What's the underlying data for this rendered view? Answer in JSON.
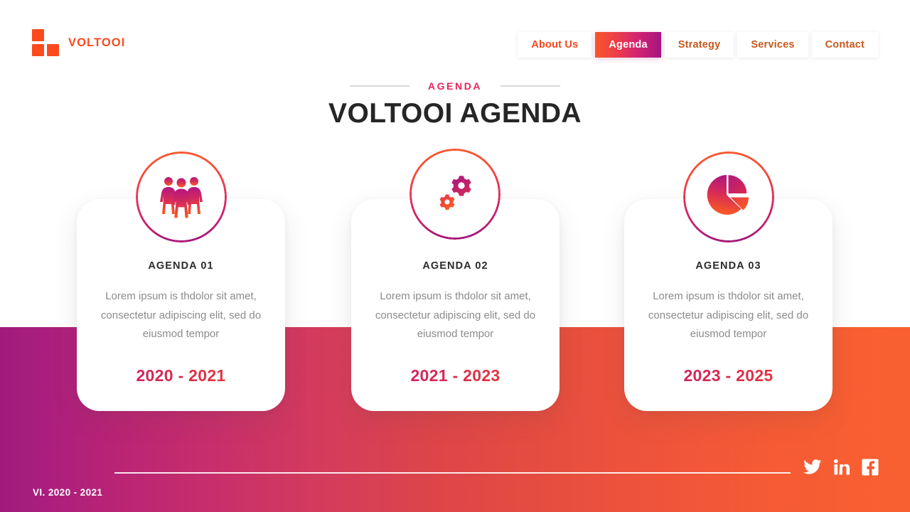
{
  "brand": {
    "name": "VOLTOOI",
    "logo_icon": "three-squares-logo-icon",
    "color": "#fb4a1e"
  },
  "nav": {
    "items": [
      {
        "label": "About Us",
        "active": false
      },
      {
        "label": "Agenda",
        "active": true
      },
      {
        "label": "Strategy",
        "active": false
      },
      {
        "label": "Services",
        "active": false
      },
      {
        "label": "Contact",
        "active": false
      }
    ],
    "active_gradient_from": "#f9562b",
    "active_gradient_to": "#a5157f",
    "inactive_color": "#c4591d",
    "first_color": "#f4481e"
  },
  "section": {
    "eyebrow": "AGENDA",
    "eyebrow_color": "#e8245c",
    "title": "VOLTOOI AGENDA",
    "title_color": "#262626"
  },
  "cards": [
    {
      "icon": "three-people-icon",
      "title": "AGENDA 01",
      "description": "Lorem ipsum is thdolor sit amet, consectetur adipiscing elit, sed do eiusmod tempor",
      "date": "2020 - 2021"
    },
    {
      "icon": "gears-icon",
      "title": "AGENDA 02",
      "description": "Lorem ipsum is thdolor sit amet, consectetur adipiscing elit, sed do eiusmod tempor",
      "date": "2021 - 2023"
    },
    {
      "icon": "pie-chart-icon",
      "title": "AGENDA 03",
      "description": "Lorem ipsum is thdolor sit amet, consectetur adipiscing elit, sed do eiusmod tempor",
      "date": "2023 - 2025"
    }
  ],
  "footer": {
    "label": "VI. 2020 - 2021",
    "socials": [
      {
        "name": "twitter-icon"
      },
      {
        "name": "linkedin-icon"
      },
      {
        "name": "facebook-icon"
      }
    ]
  },
  "theme": {
    "band_gradient_from": "#a01b7d",
    "band_gradient_to": "#f96030",
    "date_gradient_from": "#c21d78",
    "date_gradient_to": "#ef4430",
    "card_background": "#ffffff",
    "page_background": "#ffffff"
  }
}
